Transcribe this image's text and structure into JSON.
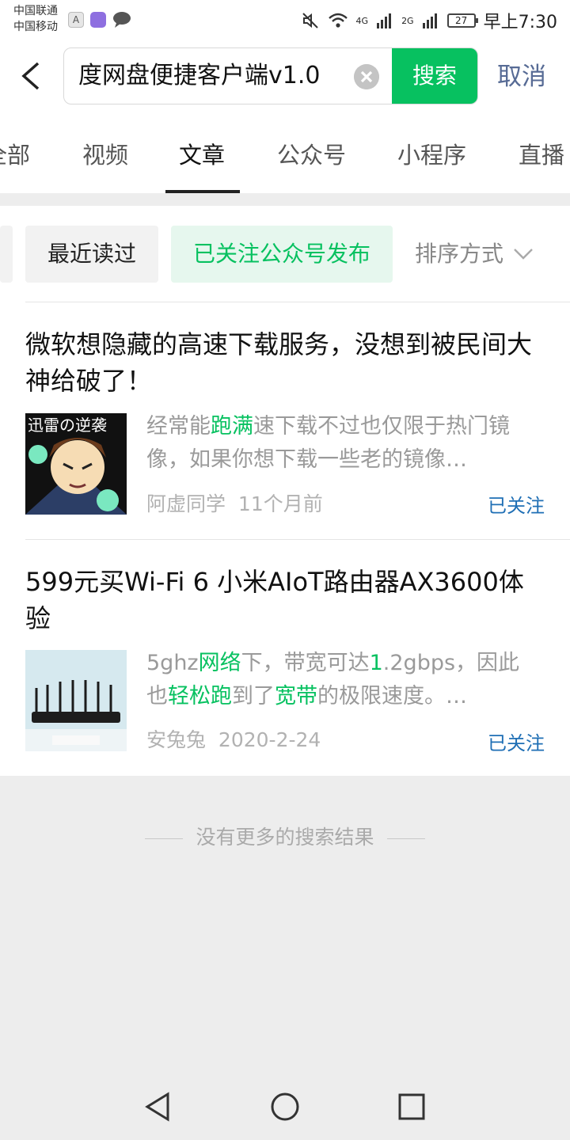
{
  "status_bar": {
    "carrier_1": "中国联通",
    "carrier_2": "中国移动",
    "app_icon_a": "A",
    "net_4g": "4G",
    "net_2g": "2G",
    "battery": "27",
    "time": "早上7:30"
  },
  "search": {
    "query": "度网盘便捷客户端v1.0",
    "button": "搜索",
    "cancel": "取消"
  },
  "tabs": [
    {
      "label": "全部"
    },
    {
      "label": "视频"
    },
    {
      "label": "文章"
    },
    {
      "label": "公众号"
    },
    {
      "label": "小程序"
    },
    {
      "label": "直播"
    }
  ],
  "filters": {
    "recent": "最近读过",
    "followed": "已关注公众号发布",
    "sort": "排序方式"
  },
  "articles": [
    {
      "title": "微软想隐藏的高速下载服务，没想到被民间大神给破了！",
      "thumb_text": "迅雷の逆袭",
      "snippet_a": "经常能",
      "snippet_hl1": "跑满",
      "snippet_b": "速下载不过也仅限于热门镜像，如果你想下载一些老的镜像…",
      "author": "阿虚同学",
      "time": "11个月前",
      "follow_status": "已关注"
    },
    {
      "title": "599元买Wi-Fi 6 小米AIoT路由器AX3600体验",
      "snippet_a": "5ghz",
      "snippet_hl1": "网络",
      "snippet_b": "下，带宽可达",
      "snippet_hl2": "1",
      "snippet_c": ".2gbps，因此也",
      "snippet_hl3": "轻松跑",
      "snippet_d": "到了",
      "snippet_hl4": "宽带",
      "snippet_e": "的极限速度。…",
      "author": "安兔兔",
      "time": "2020-2-24",
      "follow_status": "已关注"
    }
  ],
  "footer": {
    "no_more": "没有更多的搜索结果"
  },
  "colors": {
    "accent": "#07c160",
    "link": "#576b95",
    "followed": "#1f6fb5"
  }
}
